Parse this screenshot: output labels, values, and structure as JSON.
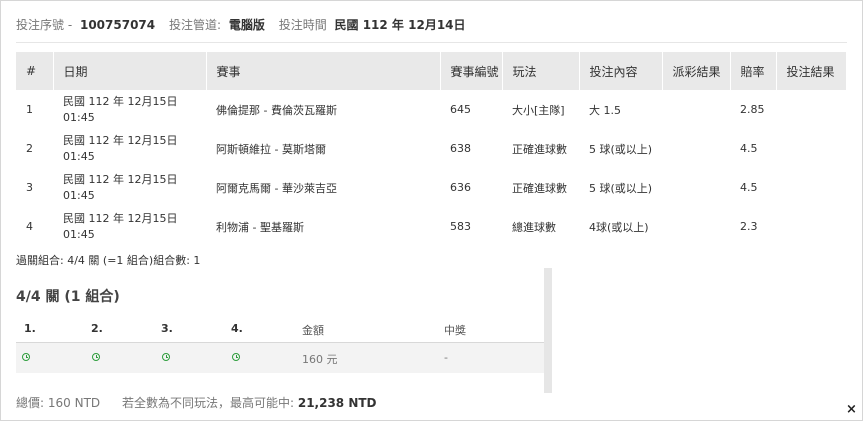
{
  "header": {
    "serial_label": "投注序號 -",
    "serial_value": "100757074",
    "channel_label": "投注管道:",
    "channel_value": "電腦版",
    "time_label": "投注時間",
    "time_value": "民國 112 年 12月14日"
  },
  "table": {
    "headers": [
      "#",
      "日期",
      "賽事",
      "賽事編號",
      "玩法",
      "投注內容",
      "派彩結果",
      "賠率",
      "投注結果"
    ],
    "rows": [
      {
        "no": "1",
        "date1": "民國 112 年 12月15日",
        "date2": "01:45",
        "match": "佛倫提那 - 費倫茨瓦羅斯",
        "id": "645",
        "play": "大小[主隊]",
        "content": "大 1.5",
        "payout": "",
        "odds": "2.85",
        "result": ""
      },
      {
        "no": "2",
        "date1": "民國 112 年 12月15日",
        "date2": "01:45",
        "match": "阿斯頓維拉 - 莫斯塔爾",
        "id": "638",
        "play": "正確進球數",
        "content": "5 球(或以上)",
        "payout": "",
        "odds": "4.5",
        "result": ""
      },
      {
        "no": "3",
        "date1": "民國 112 年 12月15日",
        "date2": "01:45",
        "match": "阿爾克馬爾 - 華沙萊吉亞",
        "id": "636",
        "play": "正確進球數",
        "content": "5 球(或以上)",
        "payout": "",
        "odds": "4.5",
        "result": ""
      },
      {
        "no": "4",
        "date1": "民國 112 年 12月15日",
        "date2": "01:45",
        "match": "利物浦 - 聖基羅斯",
        "id": "583",
        "play": "總進球數",
        "content": "4球(或以上)",
        "payout": "",
        "odds": "2.3",
        "result": ""
      }
    ]
  },
  "combo_summary": "過關組合: 4/4 關 (=1 組合)組合數: 1",
  "combo": {
    "title": "4/4 關 (1 組合)",
    "headers": [
      "1.",
      "2.",
      "3.",
      "4.",
      "金額",
      "中獎"
    ],
    "amount": "160 元",
    "win": "-",
    "status_icon": "clock-icon",
    "status_color": "#2e9e3d"
  },
  "footer": {
    "total_label": "總價:",
    "total_value": "160 NTD",
    "max_label": "若全數為不同玩法，最高可能中:",
    "max_value": "21,238 NTD"
  },
  "close_label": "×"
}
